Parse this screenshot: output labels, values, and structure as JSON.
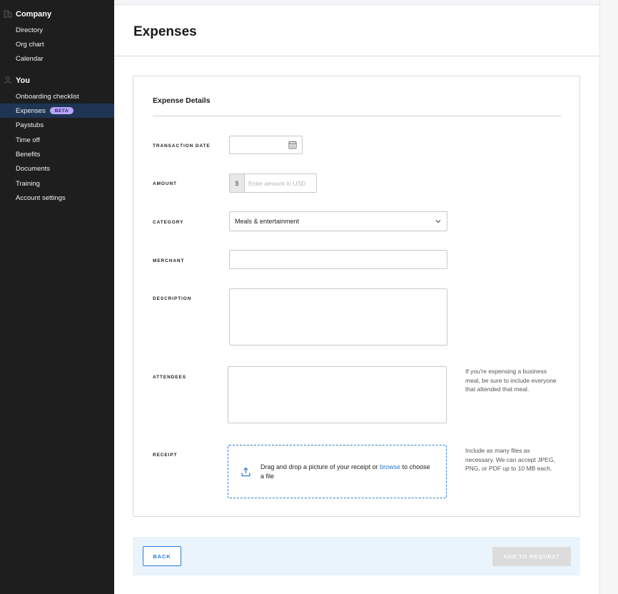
{
  "sidebar": {
    "company": {
      "title": "Company",
      "icon": "building-icon",
      "items": [
        {
          "label": "Directory"
        },
        {
          "label": "Org chart"
        },
        {
          "label": "Calendar"
        }
      ]
    },
    "you": {
      "title": "You",
      "icon": "person-icon",
      "items": [
        {
          "label": "Onboarding checklist"
        },
        {
          "label": "Expenses",
          "badge": "BETA",
          "active": true
        },
        {
          "label": "Paystubs"
        },
        {
          "label": "Time off"
        },
        {
          "label": "Benefits"
        },
        {
          "label": "Documents"
        },
        {
          "label": "Training"
        },
        {
          "label": "Account settings"
        }
      ]
    }
  },
  "main": {
    "title": "Expenses",
    "card_title": "Expense Details"
  },
  "form": {
    "transaction_date": {
      "label": "TRANSACTION DATE",
      "value": "",
      "icon": "calendar-icon"
    },
    "amount": {
      "label": "AMOUNT",
      "prefix": "$",
      "placeholder": "Enter amount in USD",
      "value": ""
    },
    "category": {
      "label": "CATEGORY",
      "value": "Meals & entertainment"
    },
    "merchant": {
      "label": "MERCHANT",
      "value": ""
    },
    "description": {
      "label": "DESCRIPTION",
      "value": ""
    },
    "attendees": {
      "label": "ATTENDEES",
      "value": "",
      "hint": "If you're expensing a business meal, be sure to include everyone that attended that meal."
    },
    "receipt": {
      "label": "RECEIPT",
      "text_before": "Drag and drop a picture of your receipt or ",
      "link": "browse",
      "text_after": " to choose a file",
      "hint": "Include as many files as necessary. We can accept JPEG, PNG, or PDF up to 10 MB each."
    }
  },
  "footer": {
    "back_label": "BACK",
    "add_label": "ADD TO REQUEST"
  },
  "colors": {
    "sidebar_bg": "#1e1e1e",
    "active_item_bg": "#1e3553",
    "beta_badge": "#b6a7f5",
    "accent": "#2b7bd1",
    "footer_bg": "#eaf4fc",
    "disabled_button": "#dcdcdc"
  }
}
